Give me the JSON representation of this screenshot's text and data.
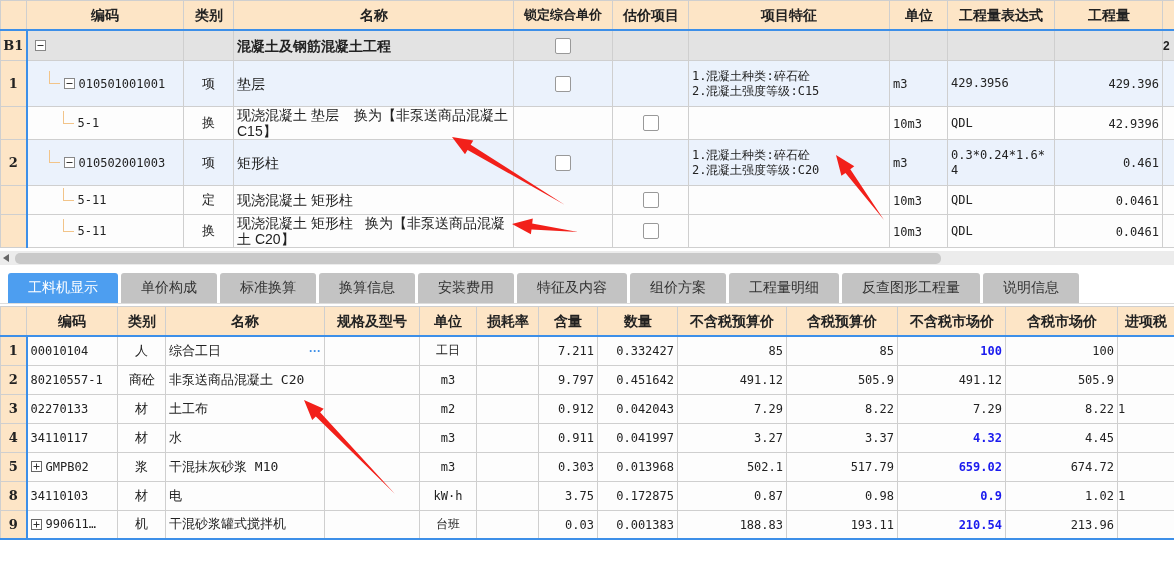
{
  "top_table": {
    "columns": [
      "编码",
      "类别",
      "名称",
      "锁定综合单价",
      "估价项目",
      "项目特征",
      "单位",
      "工程量表达式",
      "工程量"
    ],
    "rows": [
      {
        "row_number": "B1",
        "name": "混凝土及钢筋混凝土工程",
        "kind": "section",
        "expanded": true,
        "locked": false,
        "column_10": "2",
        "children": [
          {
            "row_number": "1",
            "code": "010501001001",
            "type": "项",
            "name": "垫层",
            "kind": "item",
            "expanded": true,
            "locked": false,
            "features": "1.混凝土种类:碎石砼\n2.混凝土强度等级:C15",
            "unit": "m3",
            "expression": "429.3956",
            "quantity": "429.396",
            "children": [
              {
                "code": "5-1",
                "type": "换",
                "name": "现浇混凝土 垫层    换为【非泵送商品混凝土 C15】",
                "kind": "quota",
                "estimated": false,
                "unit": "10m3",
                "expression": "QDL",
                "quantity": "42.9396"
              }
            ]
          },
          {
            "row_number": "2",
            "code": "010502001003",
            "type": "项",
            "name": "矩形柱",
            "kind": "item",
            "expanded": true,
            "locked": false,
            "features": "1.混凝土种类:碎石砼\n2.混凝土强度等级:C20",
            "unit": "m3",
            "expression": "0.3*0.24*1.6*4",
            "quantity": "0.461",
            "children": [
              {
                "code": "5-11",
                "type": "定",
                "name": "现浇混凝土 矩形柱",
                "kind": "quota",
                "estimated": false,
                "unit": "10m3",
                "expression": "QDL",
                "quantity": "0.0461"
              },
              {
                "code": "5-11",
                "type": "换",
                "name": "现浇混凝土 矩形柱   换为【非泵送商品混凝土 C20】",
                "kind": "quota",
                "estimated": false,
                "unit": "10m3",
                "expression": "QDL",
                "quantity": "0.0461"
              }
            ]
          }
        ]
      }
    ]
  },
  "tabs": [
    {
      "label": "工料机显示",
      "selected": true
    },
    {
      "label": "单价构成",
      "selected": false
    },
    {
      "label": "标准换算",
      "selected": false
    },
    {
      "label": "换算信息",
      "selected": false
    },
    {
      "label": "安装费用",
      "selected": false
    },
    {
      "label": "特征及内容",
      "selected": false
    },
    {
      "label": "组价方案",
      "selected": false
    },
    {
      "label": "工程量明细",
      "selected": false
    },
    {
      "label": "反查图形工程量",
      "selected": false
    },
    {
      "label": "说明信息",
      "selected": false
    }
  ],
  "bottom_table": {
    "columns": [
      "编码",
      "类别",
      "名称",
      "规格及型号",
      "单位",
      "损耗率",
      "含量",
      "数量",
      "不含税预算价",
      "含税预算价",
      "不含税市场价",
      "含税市场价",
      "进项税"
    ],
    "rows": [
      {
        "row_number": "1",
        "code": "00010104",
        "collapsed": false,
        "type": "人",
        "name": "综合工日",
        "action": "···",
        "unit": "工日",
        "content": "7.211",
        "amount": "0.332427",
        "budget_ex_tax": "85",
        "budget_inc_tax": "85",
        "market_ex_tax": "100",
        "adjusted": true,
        "market_inc_tax": "100"
      },
      {
        "row_number": "2",
        "code": "80210557-1",
        "collapsed": false,
        "type": "商砼",
        "name": "非泵送商品混凝土 C20",
        "unit": "m3",
        "content": "9.797",
        "amount": "0.451642",
        "budget_ex_tax": "491.12",
        "budget_inc_tax": "505.9",
        "market_ex_tax": "491.12",
        "adjusted": false,
        "market_inc_tax": "505.9"
      },
      {
        "row_number": "3",
        "code": "02270133",
        "collapsed": false,
        "type": "材",
        "name": "土工布",
        "unit": "m2",
        "content": "0.912",
        "amount": "0.042043",
        "budget_ex_tax": "7.29",
        "budget_inc_tax": "8.22",
        "market_ex_tax": "7.29",
        "adjusted": false,
        "market_inc_tax": "8.22",
        "tax_rate": "1"
      },
      {
        "row_number": "4",
        "code": "34110117",
        "collapsed": false,
        "type": "材",
        "name": "水",
        "unit": "m3",
        "content": "0.911",
        "amount": "0.041997",
        "budget_ex_tax": "3.27",
        "budget_inc_tax": "3.37",
        "market_ex_tax": "4.32",
        "adjusted": true,
        "market_inc_tax": "4.45"
      },
      {
        "row_number": "5",
        "code": "GMPB02",
        "collapsed": true,
        "type": "浆",
        "name": "干混抹灰砂浆 M10",
        "unit": "m3",
        "content": "0.303",
        "amount": "0.013968",
        "budget_ex_tax": "502.1",
        "budget_inc_tax": "517.79",
        "market_ex_tax": "659.02",
        "adjusted": true,
        "market_inc_tax": "674.72"
      },
      {
        "row_number": "8",
        "code": "34110103",
        "collapsed": false,
        "type": "材",
        "name": "电",
        "unit": "kW·h",
        "content": "3.75",
        "amount": "0.172875",
        "budget_ex_tax": "0.87",
        "budget_inc_tax": "0.98",
        "market_ex_tax": "0.9",
        "adjusted": true,
        "market_inc_tax": "1.02",
        "tax_rate": "1"
      },
      {
        "row_number": "9",
        "code": "990611…",
        "collapsed": true,
        "type": "机",
        "name": "干混砂浆罐式搅拌机",
        "unit": "台班",
        "content": "0.03",
        "amount": "0.001383",
        "budget_ex_tax": "188.83",
        "budget_inc_tax": "193.11",
        "market_ex_tax": "210.54",
        "adjusted": true,
        "market_inc_tax": "213.96"
      }
    ]
  }
}
